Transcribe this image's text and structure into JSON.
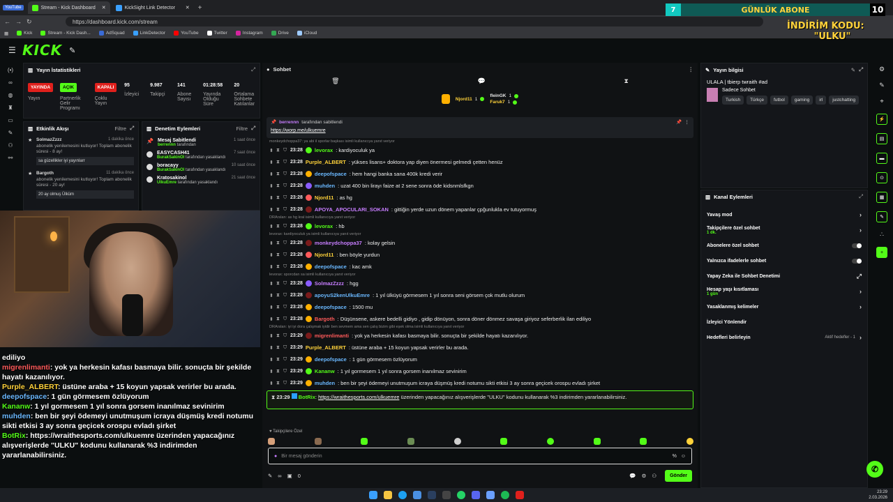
{
  "browser": {
    "badge": "YouTube",
    "tabs": [
      {
        "label": "Stream - Kick Dashboard",
        "active": true
      },
      {
        "label": "KickSight Link Detector",
        "active": false
      }
    ],
    "url": "https://dashboard.kick.com/stream",
    "bookmarks": [
      "Kick",
      "Stream - Kick Dash...",
      "AdSquad",
      "LinkDetector",
      "YouTube",
      "Twitter",
      "Instagram",
      "Drive",
      "iCloud"
    ]
  },
  "overlay": {
    "sub_number": "7",
    "sub_label": "GÜNLÜK ABONE",
    "sub_count": "10",
    "promo_line1": "İNDİRİM KODU:",
    "promo_line2": "\"ULKU\""
  },
  "stats": {
    "title": "Yayın İstatistikleri",
    "items": [
      {
        "tag": "YAYINDA",
        "tag_color": "#e0201c",
        "label": "Yayın"
      },
      {
        "tag": "AÇIK",
        "tag_color": "#53fc18",
        "label": "Partnerlik Gelir Programı"
      },
      {
        "tag": "KAPALI",
        "tag_color": "#e0201c",
        "label": "Çoklu Yayın"
      },
      {
        "value": "95",
        "label": "İzleyici"
      },
      {
        "value": "9.987",
        "label": "Takipçi"
      },
      {
        "value": "141",
        "label": "Abone Sayısı"
      },
      {
        "value": "01:28:58",
        "label": "Yayında Olduğu Süre"
      },
      {
        "value": "20",
        "label": "Ortalama Sohbete Katılanlar"
      }
    ]
  },
  "events": {
    "title": "Etkinlik Akışı",
    "filter": "Filtre",
    "items": [
      {
        "user": "SolmazZzzz",
        "time": "1 dakika önce",
        "text": "abonelik yenilemesini kutluyor! Toplam abonelik süresi - 8 ay!",
        "box": "sa güzellikler iyi yayınlarr"
      },
      {
        "user": "Bargoth",
        "time": "11 dakika önce",
        "text": "abonelik yenilemesini kutluyor! Toplam abonelik süresi - 20 ay!",
        "box": "20 ay olmuş Ülküm"
      }
    ]
  },
  "mod": {
    "title": "Denetim Eylemleri",
    "filter": "Filtre",
    "items": [
      {
        "name": "Mesaj Sabitlendi",
        "by": "berrennn",
        "action": "tarafından",
        "time": "1 saat önce"
      },
      {
        "name": "EASYCASH41",
        "by": "BurakSakinOl",
        "action": "tarafından yasaklandı",
        "time": "7 saat önce"
      },
      {
        "name": "boracayy",
        "by": "BurakSakinOl",
        "action": "tarafından yasaklandı",
        "time": "10 saat önce"
      },
      {
        "name": "Kratosakinol",
        "by": "UlkuEmre",
        "action": "tarafından yasaklandı",
        "time": "21 saat önce"
      }
    ]
  },
  "camchat": [
    {
      "user": "",
      "text": "ediliyo",
      "color": "w"
    },
    {
      "user": "migrenlimanti",
      "text": ": yok ya herkesin kafası basmaya bilir. sonuçta bir şekilde hayatı kazanılıyor.",
      "color": "r"
    },
    {
      "user": "Purple_ALBERT",
      "text": ": üstüne araba + 15 koyun yapsak verirler bu arada.",
      "color": "y"
    },
    {
      "user": "deepofspace",
      "text": ": 1 gün görmesem özlüyorum",
      "color": "b"
    },
    {
      "user": "Kananw",
      "text": ": 1 yıl gormesem 1 yıl sonra gorsem inanılmaz sevinirim",
      "color": "g"
    },
    {
      "user": "muhden",
      "text": ": ben bir şeyi ödemeyi unutmuşum icraya düşmüş kredi notumu sikti etkisi 3 ay sonra geçicek orospu evladı şirket",
      "color": "b"
    },
    {
      "user": "BotRix",
      "text": ": https://wraithesports.com/ulkuemre üzerinden yapacağınız alışverişlerde \"ULKU\" kodunu kullanarak %3 indirimden yararlanabilirsiniz.",
      "color": "g"
    }
  ],
  "chat": {
    "title": "Sohbet",
    "gifters": [
      {
        "name": "Njord11",
        "count": "1"
      },
      {
        "name": "fleinGK",
        "count": "1"
      },
      {
        "name": "Faruk7",
        "count": "1"
      }
    ],
    "pinned_by": "berrennn",
    "pinned_suffix": "tarafından sabitlendi",
    "pinned_link": "https://worp.me/ulkuemre",
    "messages": [
      {
        "reply": "monkeydchoppa37: ya abi il sporlar başkası isimli kullanıcıya yanıt veriyor",
        "time": "23:28",
        "user": "levorax",
        "color": "#53fc18",
        "badge": "#53fc18",
        "text": ": kardiyoculuk ya"
      },
      {
        "time": "23:28",
        "user": "Purple_ALBERT",
        "color": "#ffd23a",
        "badge": "",
        "text": ": yükses lisans+ doktora yap diyen önermesi gelmedi çetten henüz"
      },
      {
        "time": "23:28",
        "user": "deepofspace",
        "color": "#6ab8ff",
        "badge": "#ffb000",
        "text": ": hem hangi banka sana 400k kredi verir"
      },
      {
        "time": "23:28",
        "user": "muhden",
        "color": "#6ab8ff",
        "badge": "#8a5cff",
        "text": ": uzat 400 bin lirayı faize at 2 sene sonra öde kidsnmlsfkgn"
      },
      {
        "time": "23:28",
        "user": "Njord11",
        "color": "#ffd23a",
        "badge": "#ff5a5a",
        "text": ": as hg"
      },
      {
        "time": "23:28",
        "user": "APOYA_APOCULARI_SOKAN",
        "color": "#c77dff",
        "badge": "#7a1b1b",
        "text": ": gittiğin yerde uzun dönem yapanlar çpğunlukla ev tutuyormuş"
      },
      {
        "reply": "DRArslan: as hg kral isimli kullanıcıya yanıt veriyor",
        "time": "23:28",
        "user": "levorax",
        "color": "#53fc18",
        "badge": "#53fc18",
        "text": ": hb"
      },
      {
        "reply": "levorax: kardiyoculuk ya isimli kullanıcıya yanıt veriyor",
        "time": "23:28",
        "user": "monkeydchoppa37",
        "color": "#c77dff",
        "badge": "#7a1b1b",
        "text": ": kolay gelsin"
      },
      {
        "time": "23:28",
        "user": "Njord11",
        "color": "#ffd23a",
        "badge": "#ff5a5a",
        "text": ": ben böyle yurdun"
      },
      {
        "time": "23:28",
        "user": "deepofspace",
        "color": "#6ab8ff",
        "badge": "#ffb000",
        "text": ": kac amk"
      },
      {
        "reply": "levorax: sporcdan sa isimli kullanıcıya yanıt veriyor",
        "time": "23:28",
        "user": "SolmazZzzz",
        "color": "#c77dff",
        "badge": "#8a5cff",
        "text": ": hgg"
      },
      {
        "time": "23:28",
        "user": "apoyuS2kenUlkuEmre",
        "color": "#6ab8ff",
        "badge": "#7a1b1b",
        "text": ": 1 yıl ülküyü görmesem 1 yıl sonra seni görsem çok mutlu olurum"
      },
      {
        "time": "23:28",
        "user": "deepofspace",
        "color": "#6ab8ff",
        "badge": "#ffb000",
        "text": ": 1500 mu"
      },
      {
        "time": "23:28",
        "user": "Bargoth",
        "color": "#ff5a5a",
        "badge": "#ffb000",
        "text": ": Düşünsene, askere bedelli gidiyo , gidip dönüyon, sonra döner dönmez savaşa giriyoz seferberlik ilan ediliyo"
      },
      {
        "reply": "DRArslan: iyi iyi dora çalışmak iyidir ben sevmem ama sen çalış bizim gibi eşek olma isimli kullanıcıya yanıt veriyor",
        "time": "23:29",
        "user": "migrenlimanti",
        "color": "#ff5a5a",
        "badge": "#7a1b1b",
        "text": ": yok ya herkesin kafası basmaya bilir. sonuçta bir şekilde hayatı kazanılıyor."
      },
      {
        "time": "23:29",
        "user": "Purple_ALBERT",
        "color": "#ffd23a",
        "badge": "",
        "text": ": üstüne araba + 15 koyun yapsak verirler bu arada."
      },
      {
        "time": "23:29",
        "user": "deepofspace",
        "color": "#6ab8ff",
        "badge": "#ffb000",
        "text": ": 1 gün görmesem özlüyorum"
      },
      {
        "time": "23:29",
        "user": "Kananw",
        "color": "#53fc18",
        "badge": "#53fc18",
        "text": ": 1 yıl gormesem 1 yıl sonra gorsem inanılmaz sevinirim"
      },
      {
        "time": "23:29",
        "user": "muhden",
        "color": "#6ab8ff",
        "badge": "#ffb000",
        "text": ": ben bir şeyi ödemeyi unutmuşum icraya düşmüş kredi notumu sikti etkisi 3 ay sonra geçicek orospu evladı şirket"
      }
    ],
    "bot": {
      "time": "23:29",
      "user": "BotRix",
      "link": "https://wraithesports.com/ulkuemre",
      "text": "üzerinden yapacağınız alışverişlerde \"ULKU\" kodunu kullanarak %3 indirimden yararlanabilirsiniz."
    },
    "follow_label": "Takipçilere Özel",
    "input_placeholder": "Bir mesaj gönderin",
    "count": "0",
    "send_label": "Gönder"
  },
  "info": {
    "title": "Yayın bilgisi",
    "stream_title": "ULALA | tbierp twraith #ad",
    "category": "Sadece Sohbet",
    "tags": [
      "Turkish",
      "Türkçe",
      "futbol",
      "gaming",
      "irl",
      "justchatting"
    ]
  },
  "channel": {
    "title": "Kanal Eylemleri",
    "rows": [
      {
        "label": "Yavaş mod",
        "sub": "",
        "control": "chevron"
      },
      {
        "label": "Takipçilere özel sohbet",
        "sub": "1 dk.",
        "control": "chevron"
      },
      {
        "label": "Abonelere özel sohbet",
        "sub": "",
        "control": "toggle"
      },
      {
        "label": "Yalnızca ifadelerle sohbet",
        "sub": "",
        "control": "toggle"
      },
      {
        "label": "Yapay Zeka ile Sohbet Denetimi",
        "sub": "",
        "control": "external"
      },
      {
        "label": "Hesap yaşı kısıtlaması",
        "sub": "1 gün",
        "control": "chevron"
      },
      {
        "label": "Yasaklanmış kelimeler",
        "sub": "",
        "control": "chevron"
      },
      {
        "label": "İzleyici Yönlendir",
        "sub": "",
        "control": ""
      },
      {
        "label": "Hedefleri belirleyin",
        "sub": "",
        "control": "chevron"
      }
    ],
    "goal_status": "Aktif hedefler - 1"
  },
  "taskbar": {
    "time": "23:29",
    "date": "2.03.2026"
  }
}
